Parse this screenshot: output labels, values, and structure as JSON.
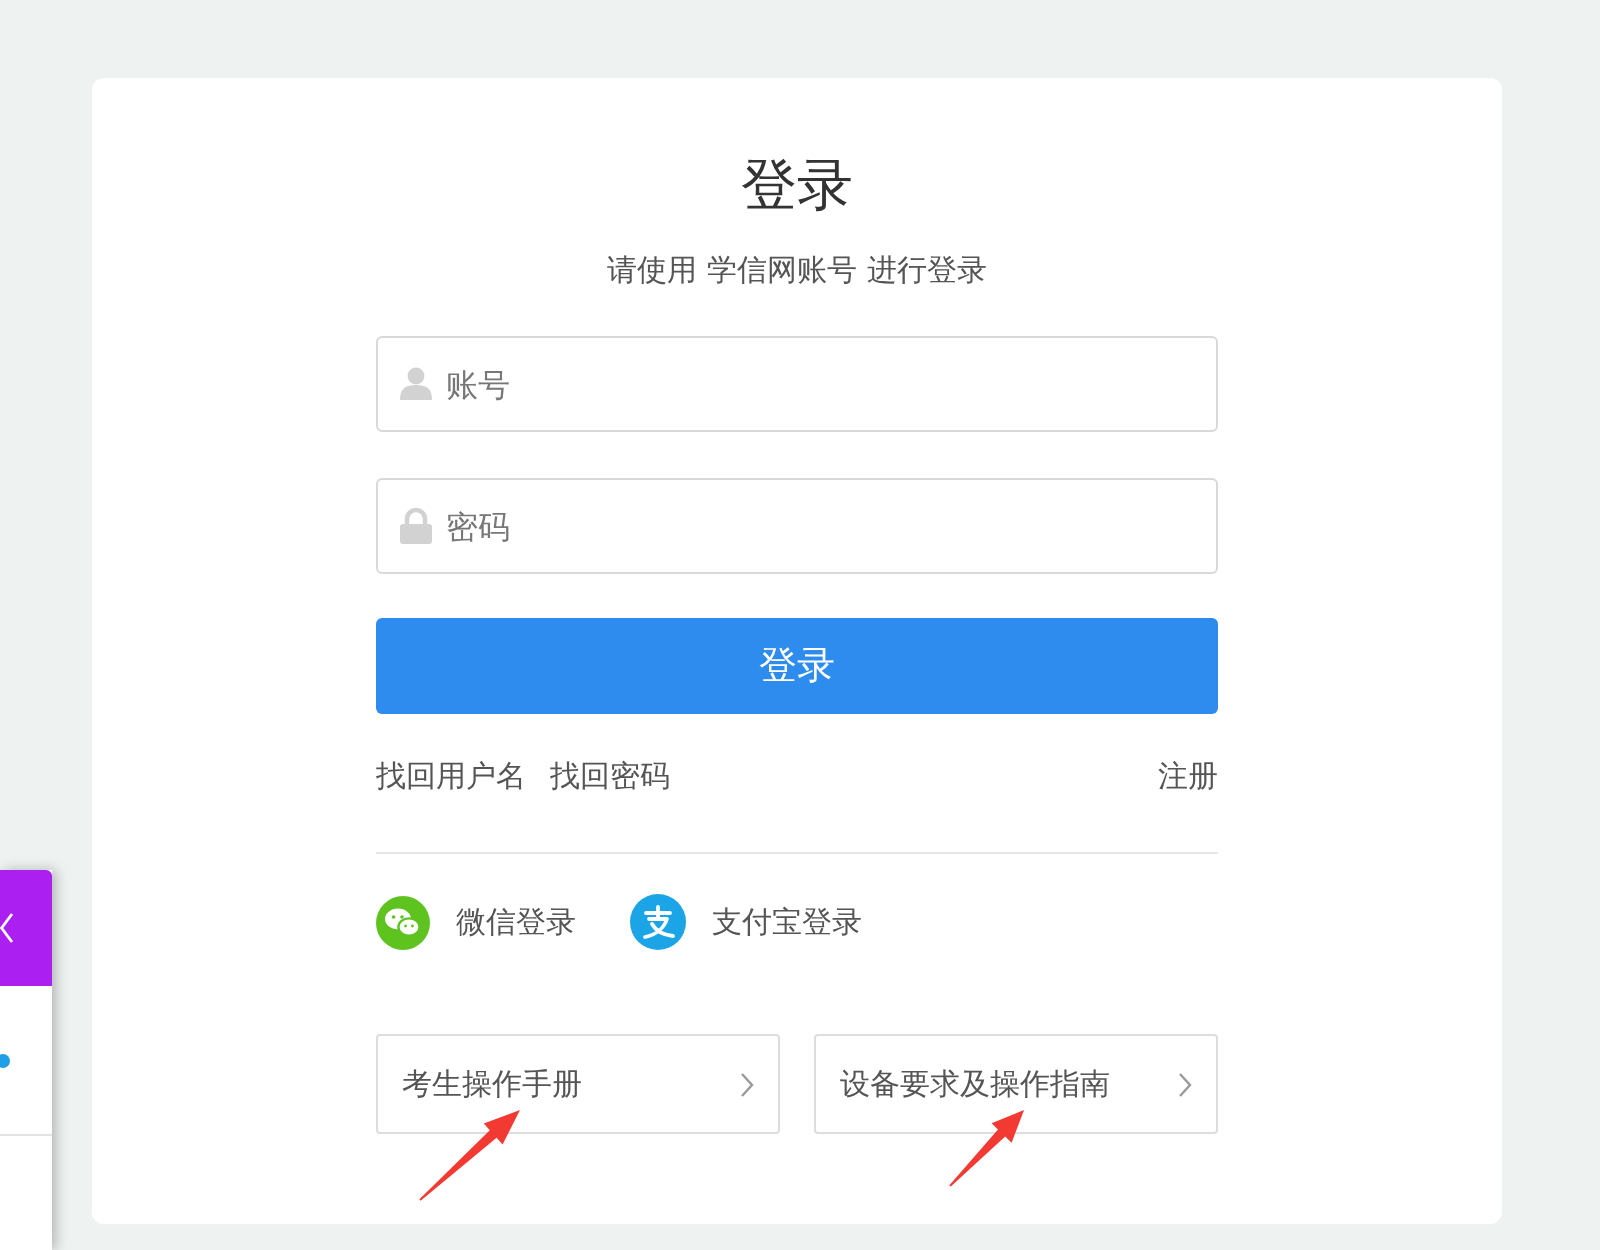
{
  "title": "登录",
  "subtitle": "请使用 学信网账号 进行登录",
  "fields": [
    {
      "kind": "user",
      "placeholder": "账号"
    },
    {
      "kind": "password",
      "placeholder": "密码"
    }
  ],
  "submit": "登录",
  "links": [
    {
      "label": "找回用户名"
    },
    {
      "label": "找回密码"
    }
  ],
  "register": "注册",
  "social_logins": [
    {
      "kind": "wechat",
      "label": "微信登录"
    },
    {
      "kind": "alipay",
      "label": "支付宝登录"
    }
  ],
  "guides": [
    {
      "label": "考生操作手册"
    },
    {
      "label": "设备要求及操作指南"
    }
  ]
}
